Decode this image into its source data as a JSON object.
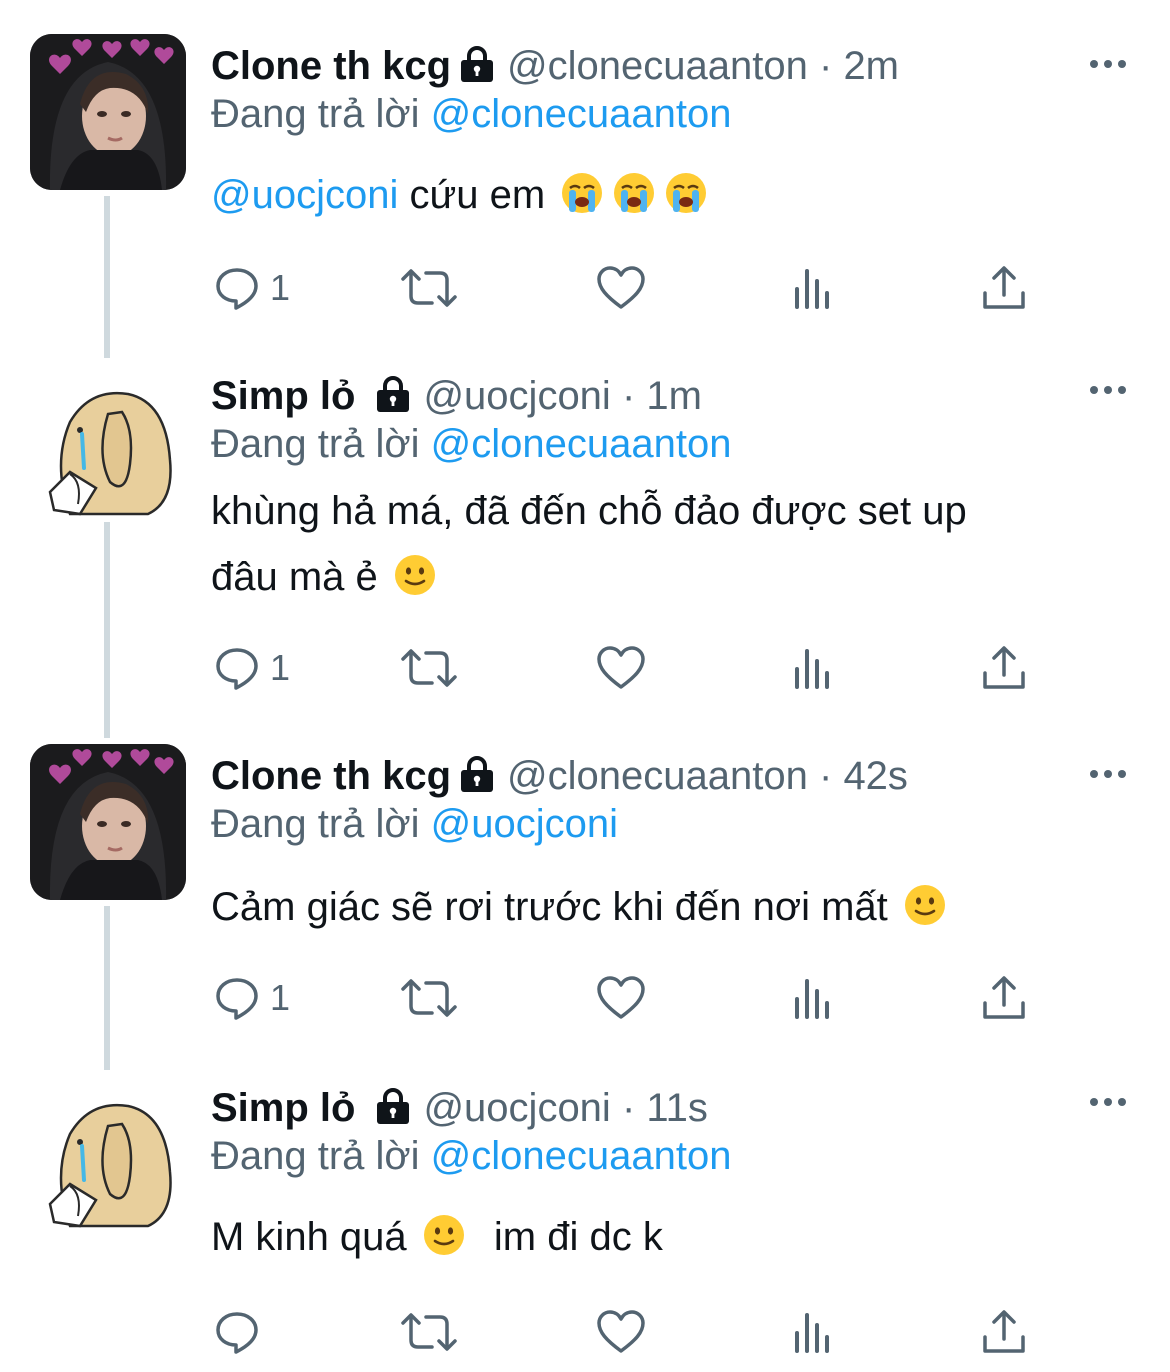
{
  "tweets": [
    {
      "avatar": "avatar-dark-hood",
      "name": "Clone th kcg",
      "handle": "@clonecuaanton",
      "time": "2m",
      "replying_label": "Đang trả lời",
      "replying_to": "@clonecuaanton",
      "mention": "@uocjconi",
      "text_lines": [
        "cứu em"
      ],
      "emojis": [
        "loudly-crying",
        "loudly-crying",
        "loudly-crying"
      ],
      "reply_count": "1"
    },
    {
      "avatar": "avatar-crying-dog",
      "name": "Simp lỏ",
      "handle": "@uocjconi",
      "time": "1m",
      "replying_label": "Đang trả lời",
      "replying_to": "@clonecuaanton",
      "text_lines": [
        "khùng hả má, đã đến chỗ đảo được set up",
        "đâu mà ẻ"
      ],
      "emojis": [
        "slight-smile"
      ],
      "reply_count": "1"
    },
    {
      "avatar": "avatar-dark-hood",
      "name": "Clone th kcg",
      "handle": "@clonecuaanton",
      "time": "42s",
      "replying_label": "Đang trả lời",
      "replying_to": "@uocjconi",
      "text_lines": [
        "Cảm giác sẽ rơi trước khi đến nơi mất"
      ],
      "emojis": [
        "slight-smile"
      ],
      "reply_count": "1"
    },
    {
      "avatar": "avatar-crying-dog",
      "name": "Simp lỏ",
      "handle": "@uocjconi",
      "time": "11s",
      "replying_label": "Đang trả lời",
      "replying_to": "@clonecuaanton",
      "text_before_emoji": "M kinh quá",
      "text_after_emoji": "im đi dc k",
      "emojis": [
        "slight-smile"
      ],
      "reply_count": ""
    }
  ],
  "separator": "·",
  "icons": [
    "lock-icon",
    "more-icon",
    "reply-icon",
    "retweet-icon",
    "like-icon",
    "views-icon",
    "share-icon"
  ],
  "colors": {
    "link": "#1d9bf0",
    "secondary": "#536471",
    "primary_text": "#0f1419",
    "thread_line": "#cfd9de"
  }
}
